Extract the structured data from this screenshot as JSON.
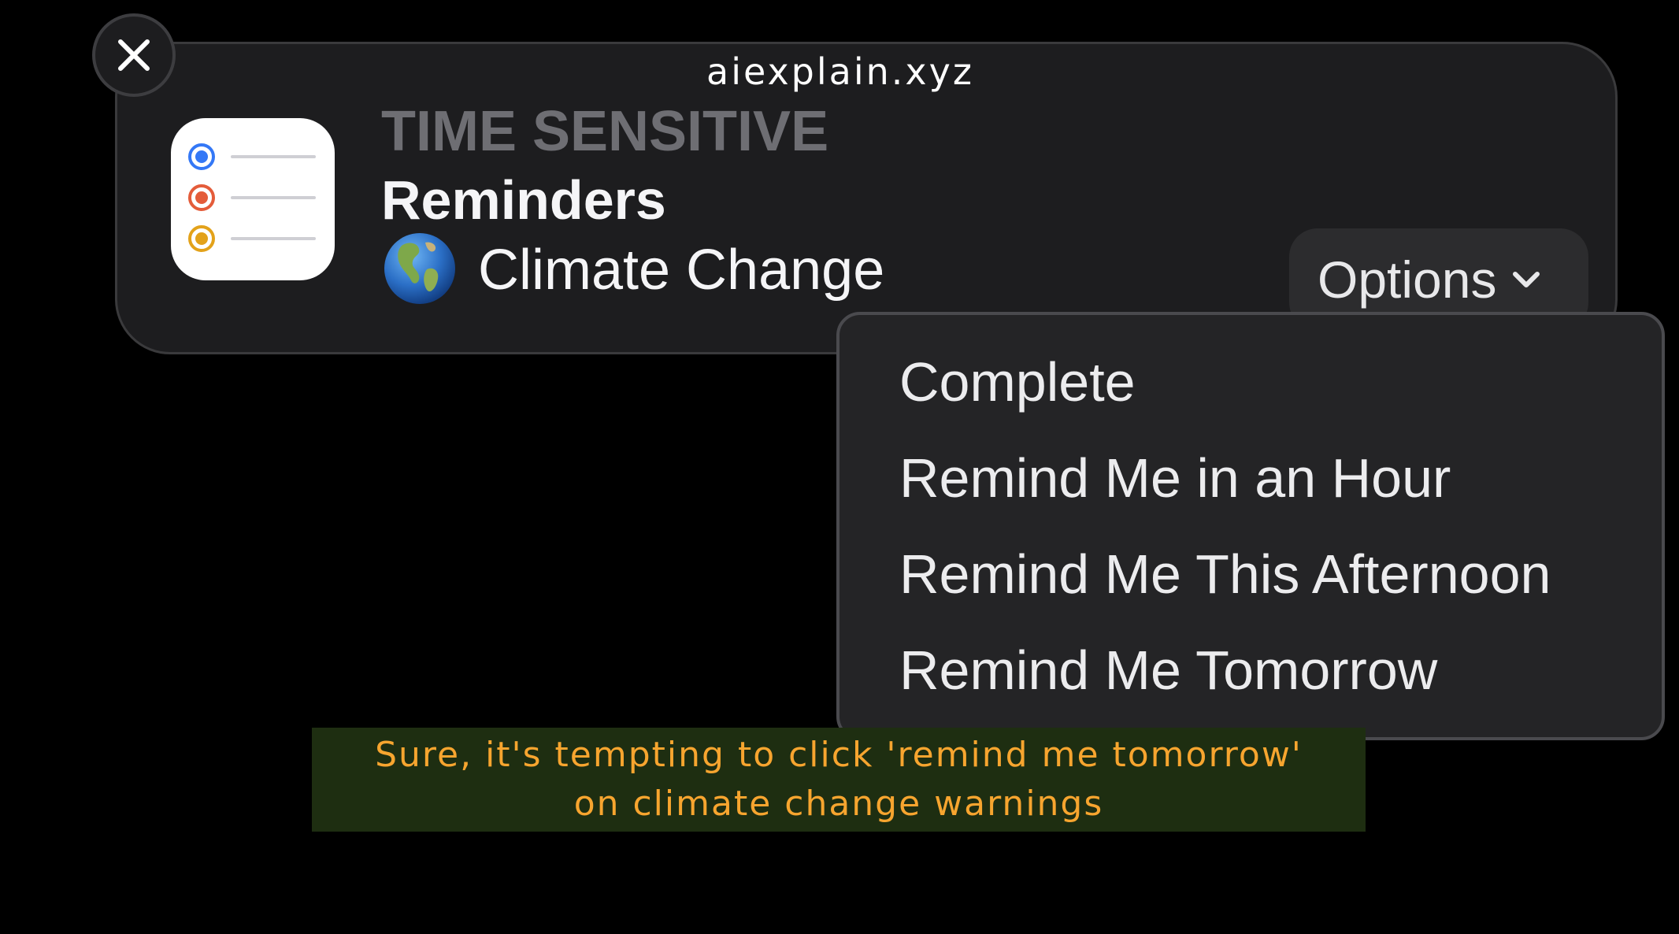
{
  "watermark": "aiexplain.xyz",
  "notification": {
    "header": "TIME SENSITIVE",
    "app_name": "Reminders",
    "title": "Climate Change",
    "title_emoji": "globe-americas",
    "options_label": "Options",
    "app_icon_dot_colors": [
      "#3478f6",
      "#e45c3a",
      "#e3a21a"
    ]
  },
  "menu": {
    "items": [
      "Complete",
      "Remind Me in an Hour",
      "Remind Me This Afternoon",
      "Remind Me Tomorrow"
    ]
  },
  "caption": {
    "line1": "Sure, it's tempting to click 'remind me tomorrow'",
    "line2": "on climate change warnings"
  }
}
